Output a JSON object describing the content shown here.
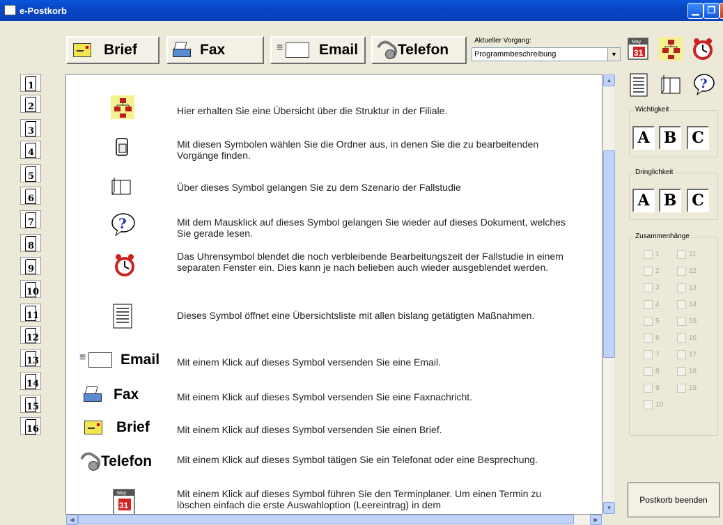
{
  "window": {
    "title": "e-Postkorb",
    "buttons": [
      "minimize",
      "restore",
      "close"
    ]
  },
  "channels": [
    {
      "label": "Brief",
      "icon": "letter-icon"
    },
    {
      "label": "Fax",
      "icon": "fax-icon"
    },
    {
      "label": "Email",
      "icon": "email-icon"
    },
    {
      "label": "Telefon",
      "icon": "telephone-icon"
    }
  ],
  "vorgang": {
    "label": "Aktueller Vorgang:",
    "value": "Programmbeschreibung"
  },
  "toolbar_icons": [
    "calendar-icon",
    "org-chart-icon",
    "alarm-clock-icon",
    "list-icon",
    "book-icon",
    "help-icon"
  ],
  "folders": [
    "1",
    "2",
    "3",
    "4",
    "5",
    "6",
    "7",
    "8",
    "9",
    "10",
    "11",
    "12",
    "13",
    "14",
    "15",
    "16"
  ],
  "content": {
    "rows": [
      {
        "icon": "org-chart-icon",
        "text": "Hier erhalten Sie eine Übersicht über die Struktur in der Filiale."
      },
      {
        "icon": "folder-icon",
        "text": "Mit diesen Symbolen wählen Sie die Ordner aus, in denen Sie die zu bearbeitenden Vorgänge finden."
      },
      {
        "icon": "book-icon",
        "text": "Über dieses Symbol gelangen Sie zu dem Szenario der Fallstudie"
      },
      {
        "icon": "help-icon",
        "text": "Mit dem Mausklick auf dieses Symbol gelangen Sie wieder auf dieses Dokument, welches Sie gerade lesen."
      },
      {
        "icon": "alarm-clock-icon",
        "text": "Das Uhrensymbol blendet die noch verbleibende Bearbeitungszeit der Fallstudie in einem separaten Fenster ein. Dies kann je nach belieben auch wieder ausgeblendet werden."
      },
      {
        "icon": "list-icon",
        "text": "Dieses Symbol öffnet eine Übersichtsliste mit allen bislang getätigten Maßnahmen."
      },
      {
        "icon": "email-icon",
        "label": "Email",
        "text": "Mit einem Klick auf dieses Symbol versenden Sie eine Email."
      },
      {
        "icon": "fax-icon",
        "label": "Fax",
        "text": "Mit einem Klick auf dieses Symbol versenden Sie eine Faxnachricht."
      },
      {
        "icon": "letter-icon",
        "label": "Brief",
        "text": "Mit einem Klick auf dieses Symbol versenden Sie einen Brief."
      },
      {
        "icon": "telephone-icon",
        "label": "Telefon",
        "text": "Mit einem Klick auf dieses Symbol tätigen Sie ein Telefonat oder eine Besprechung."
      },
      {
        "icon": "calendar-icon",
        "text": "Mit einem Klick auf dieses Symbol führen Sie den Terminplaner. Um einen Termin zu löschen einfach die erste Auswahloption (Leereintrag) in dem"
      }
    ]
  },
  "wichtigkeit": {
    "title": "Wichtigkeit",
    "options": [
      "A",
      "B",
      "C"
    ]
  },
  "dringlichkeit": {
    "title": "Dringlichkeit",
    "options": [
      "A",
      "B",
      "C"
    ]
  },
  "zusammenhaenge": {
    "title": "Zusammenhänge",
    "left": [
      "1",
      "2",
      "3",
      "4",
      "5",
      "6",
      "7",
      "8",
      "9",
      "10"
    ],
    "right": [
      "11",
      "12",
      "13",
      "14",
      "15",
      "16",
      "17",
      "18",
      "19"
    ]
  },
  "end_button": "Postkorb beenden",
  "calendar_icon_text": {
    "month": "May",
    "day": "31"
  },
  "help_icon_text": "?"
}
